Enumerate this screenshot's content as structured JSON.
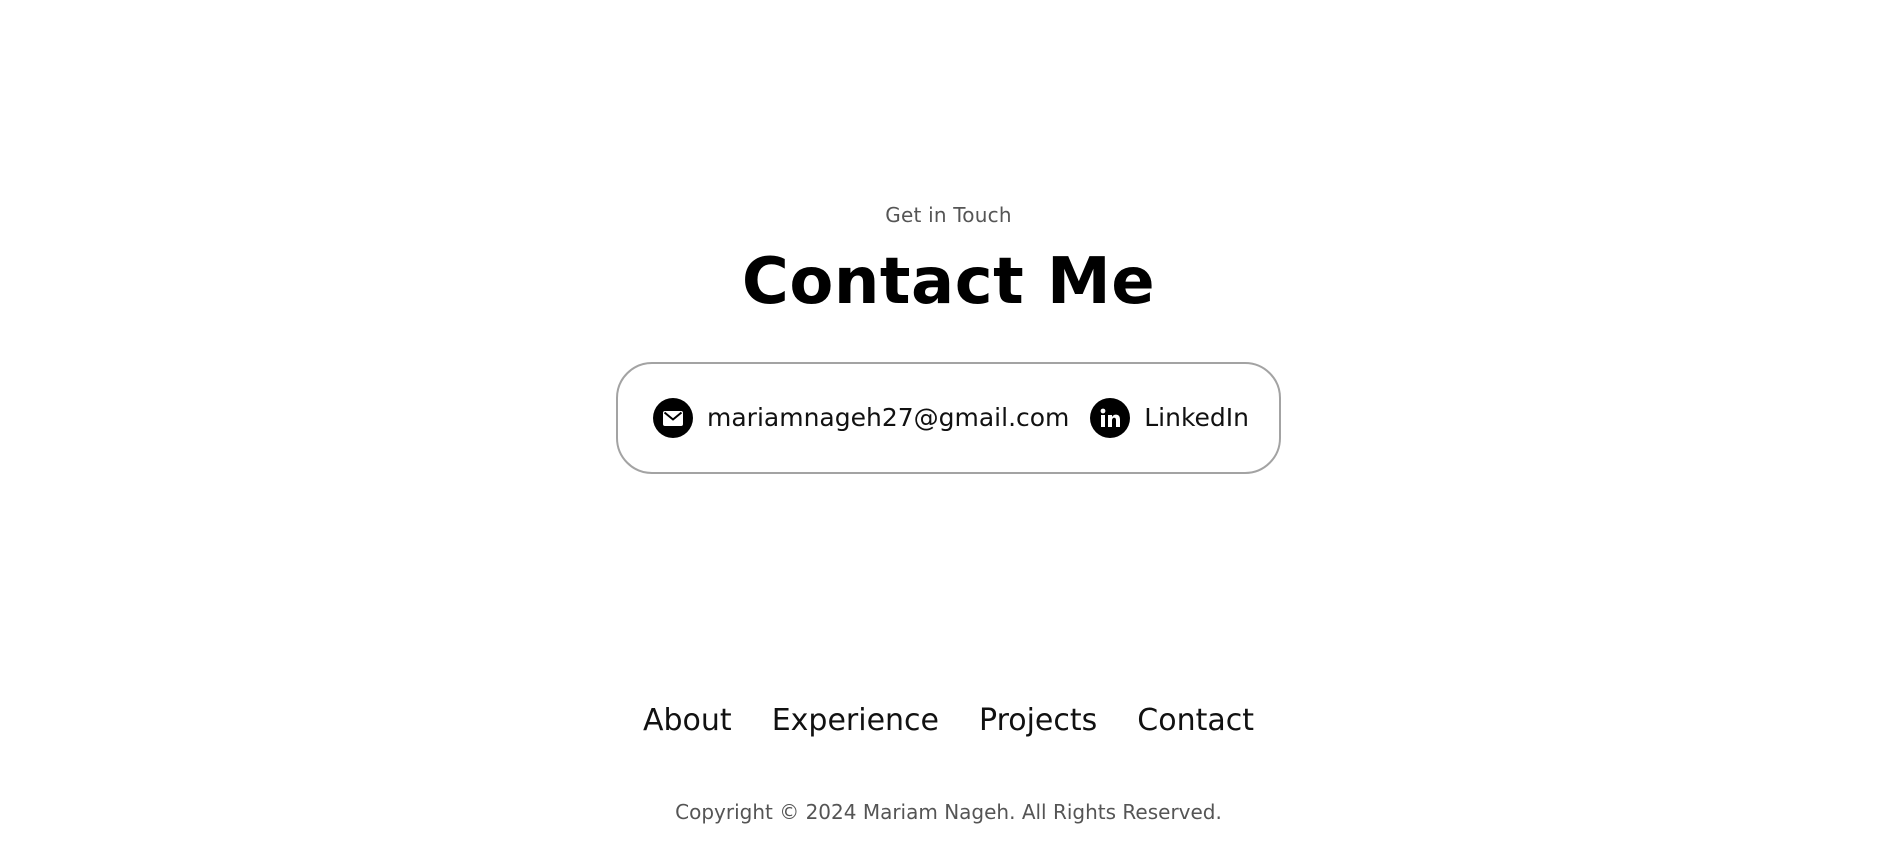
{
  "contact_section": {
    "eyebrow": "Get in Touch",
    "title": "Contact Me",
    "email": {
      "icon": "envelope-icon",
      "label": "mariamnageh27@gmail.com"
    },
    "linkedin": {
      "icon": "linkedin-icon",
      "label": "LinkedIn"
    }
  },
  "footer": {
    "nav": [
      "About",
      "Experience",
      "Projects",
      "Contact"
    ],
    "copyright": "Copyright © 2024 Mariam Nageh. All Rights Reserved."
  },
  "colors": {
    "text": "#000000",
    "muted": "#555555",
    "border": "#a3a3a3",
    "background": "#ffffff"
  }
}
